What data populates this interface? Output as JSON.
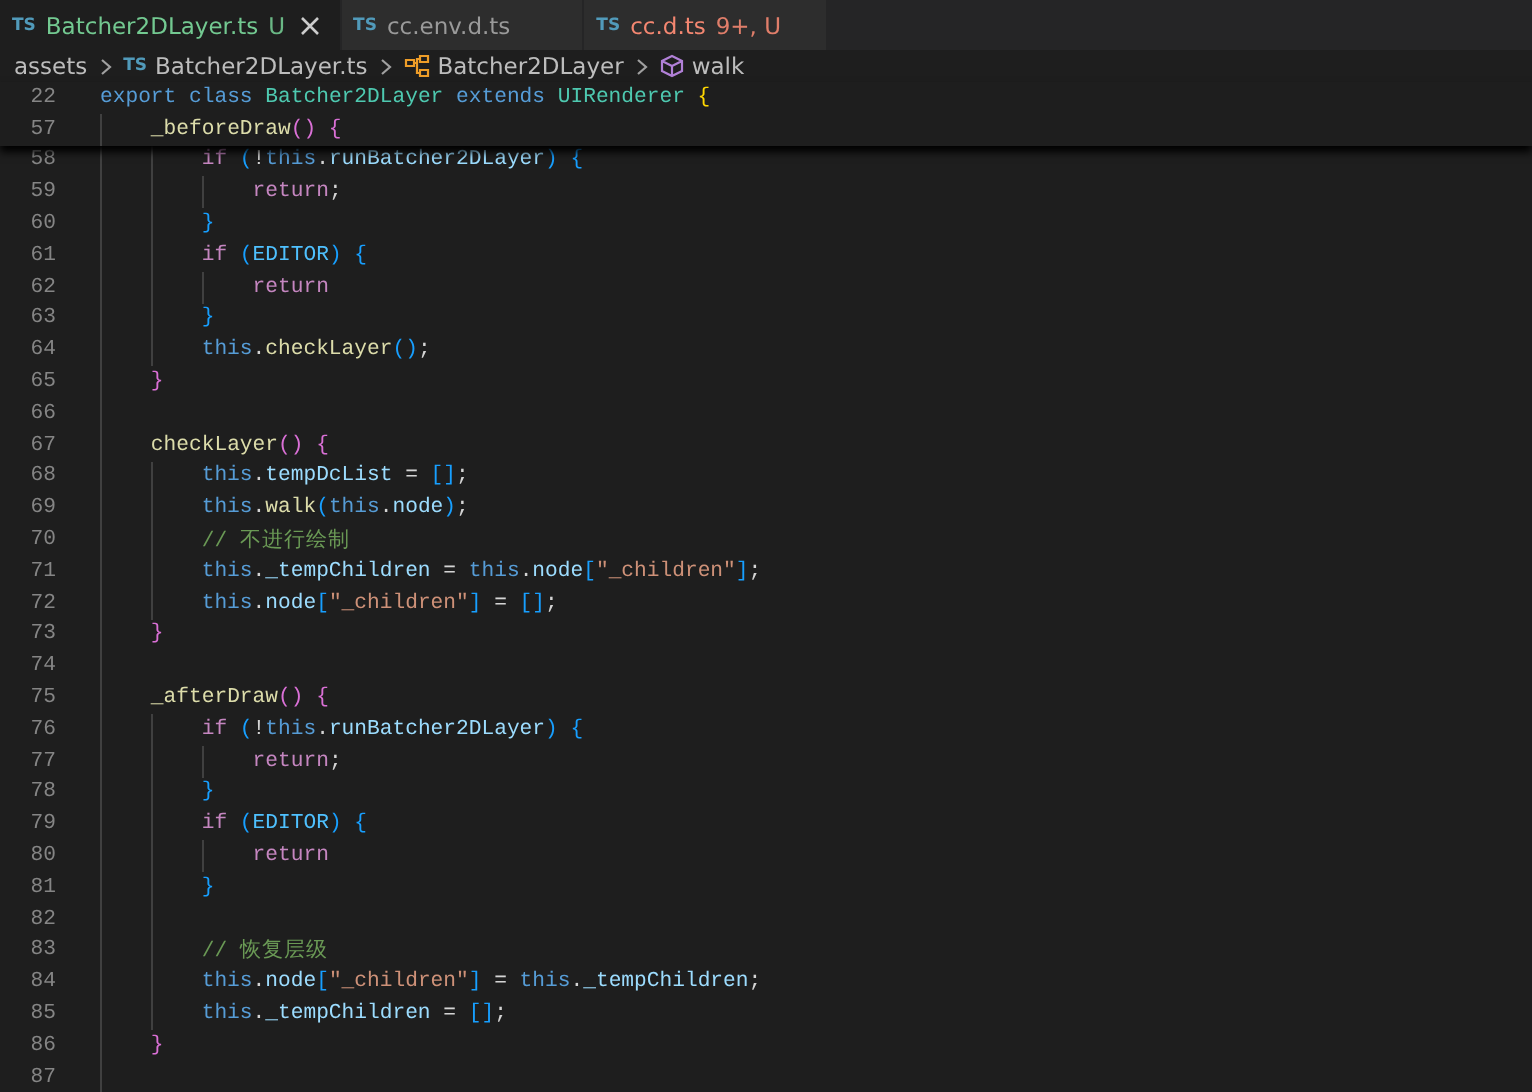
{
  "tabs": [
    {
      "badge": "TS",
      "label": "Batcher2DLayer.ts",
      "status": "U",
      "color": "#73c991",
      "selected": true
    },
    {
      "badge": "TS",
      "label": "cc.env.d.ts",
      "color": "#9a9a9a",
      "selected": false
    },
    {
      "badge": "TS",
      "label": "cc.d.ts",
      "status": "9+, U",
      "color": "#f48771",
      "selected": false
    }
  ],
  "breadcrumb": [
    {
      "text": "assets",
      "kind": "folder"
    },
    {
      "badge": "TS",
      "text": "Batcher2DLayer.ts",
      "kind": "file"
    },
    {
      "text": "Batcher2DLayer",
      "kind": "class"
    },
    {
      "text": "walk",
      "kind": "method"
    }
  ],
  "sticky_lines": [
    {
      "number": "22",
      "tokens": [
        {
          "text": "export class",
          "kind": "keyword"
        },
        {
          "text": " Batcher2DLayer",
          "kind": "type"
        },
        {
          "text": " extends",
          "kind": "keyword"
        },
        {
          "text": " UIRenderer",
          "kind": "type"
        },
        {
          "text": " {",
          "kind": "bracket1"
        }
      ]
    },
    {
      "number": "57",
      "tokens": [
        {
          "text": "    _beforeDraw",
          "kind": "function"
        },
        {
          "text": "() {",
          "kind": "bracket2"
        }
      ]
    }
  ],
  "lines": [
    {
      "number": "58",
      "tokens": [
        {
          "text": "        if",
          "kind": "control"
        },
        {
          "text": " (",
          "kind": "bracket3"
        },
        {
          "text": "!",
          "kind": "punctuation"
        },
        {
          "text": "this",
          "kind": "keyword"
        },
        {
          "text": ".",
          "kind": "punctuation"
        },
        {
          "text": "runBatcher2DLayer",
          "kind": "property"
        },
        {
          "text": ") {",
          "kind": "bracket3"
        }
      ]
    },
    {
      "number": "59",
      "tokens": [
        {
          "text": "            return",
          "kind": "control"
        },
        {
          "text": ";",
          "kind": "punctuation"
        }
      ]
    },
    {
      "number": "60",
      "tokens": [
        {
          "text": "        }",
          "kind": "bracket3"
        }
      ]
    },
    {
      "number": "61",
      "tokens": [
        {
          "text": "        if",
          "kind": "control"
        },
        {
          "text": " (",
          "kind": "bracket3"
        },
        {
          "text": "EDITOR",
          "kind": "constant"
        },
        {
          "text": ") {",
          "kind": "bracket3"
        }
      ]
    },
    {
      "number": "62",
      "tokens": [
        {
          "text": "            return",
          "kind": "control"
        }
      ]
    },
    {
      "number": "63",
      "tokens": [
        {
          "text": "        }",
          "kind": "bracket3"
        }
      ]
    },
    {
      "number": "64",
      "tokens": [
        {
          "text": "        this",
          "kind": "keyword"
        },
        {
          "text": ".",
          "kind": "punctuation"
        },
        {
          "text": "checkLayer",
          "kind": "function"
        },
        {
          "text": "()",
          "kind": "bracket3"
        },
        {
          "text": ";",
          "kind": "punctuation"
        }
      ]
    },
    {
      "number": "65",
      "tokens": [
        {
          "text": "    }",
          "kind": "bracket2"
        }
      ]
    },
    {
      "number": "66"
    },
    {
      "number": "67",
      "tokens": [
        {
          "text": "    checkLayer",
          "kind": "function"
        },
        {
          "text": "() {",
          "kind": "bracket2"
        }
      ]
    },
    {
      "number": "68",
      "tokens": [
        {
          "text": "        this",
          "kind": "keyword"
        },
        {
          "text": ".",
          "kind": "punctuation"
        },
        {
          "text": "tempDcList",
          "kind": "property"
        },
        {
          "text": " =",
          "kind": "punctuation"
        },
        {
          "text": " []",
          "kind": "bracket3"
        },
        {
          "text": ";",
          "kind": "punctuation"
        }
      ]
    },
    {
      "number": "69",
      "tokens": [
        {
          "text": "        this",
          "kind": "keyword"
        },
        {
          "text": ".",
          "kind": "punctuation"
        },
        {
          "text": "walk",
          "kind": "function"
        },
        {
          "text": "(",
          "kind": "bracket3"
        },
        {
          "text": "this",
          "kind": "keyword"
        },
        {
          "text": ".",
          "kind": "punctuation"
        },
        {
          "text": "node",
          "kind": "property"
        },
        {
          "text": ")",
          "kind": "bracket3"
        },
        {
          "text": ";",
          "kind": "punctuation"
        }
      ]
    },
    {
      "number": "70",
      "tokens": [
        {
          "text": "        // 不进行绘制",
          "kind": "comment"
        }
      ]
    },
    {
      "number": "71",
      "tokens": [
        {
          "text": "        this",
          "kind": "keyword"
        },
        {
          "text": ".",
          "kind": "punctuation"
        },
        {
          "text": "_tempChildren",
          "kind": "property"
        },
        {
          "text": " =",
          "kind": "punctuation"
        },
        {
          "text": " this",
          "kind": "keyword"
        },
        {
          "text": ".",
          "kind": "punctuation"
        },
        {
          "text": "node",
          "kind": "property"
        },
        {
          "text": "[",
          "kind": "bracket3"
        },
        {
          "text": "\"_children\"",
          "kind": "string"
        },
        {
          "text": "]",
          "kind": "bracket3"
        },
        {
          "text": ";",
          "kind": "punctuation"
        }
      ]
    },
    {
      "number": "72",
      "tokens": [
        {
          "text": "        this",
          "kind": "keyword"
        },
        {
          "text": ".",
          "kind": "punctuation"
        },
        {
          "text": "node",
          "kind": "property"
        },
        {
          "text": "[",
          "kind": "bracket3"
        },
        {
          "text": "\"_children\"",
          "kind": "string"
        },
        {
          "text": "]",
          "kind": "bracket3"
        },
        {
          "text": " =",
          "kind": "punctuation"
        },
        {
          "text": " []",
          "kind": "bracket3"
        },
        {
          "text": ";",
          "kind": "punctuation"
        }
      ]
    },
    {
      "number": "73",
      "tokens": [
        {
          "text": "    }",
          "kind": "bracket2"
        }
      ]
    },
    {
      "number": "74"
    },
    {
      "number": "75",
      "tokens": [
        {
          "text": "    _afterDraw",
          "kind": "function"
        },
        {
          "text": "() {",
          "kind": "bracket2"
        }
      ]
    },
    {
      "number": "76",
      "tokens": [
        {
          "text": "        if",
          "kind": "control"
        },
        {
          "text": " (",
          "kind": "bracket3"
        },
        {
          "text": "!",
          "kind": "punctuation"
        },
        {
          "text": "this",
          "kind": "keyword"
        },
        {
          "text": ".",
          "kind": "punctuation"
        },
        {
          "text": "runBatcher2DLayer",
          "kind": "property"
        },
        {
          "text": ") {",
          "kind": "bracket3"
        }
      ]
    },
    {
      "number": "77",
      "tokens": [
        {
          "text": "            return",
          "kind": "control"
        },
        {
          "text": ";",
          "kind": "punctuation"
        }
      ]
    },
    {
      "number": "78",
      "tokens": [
        {
          "text": "        }",
          "kind": "bracket3"
        }
      ]
    },
    {
      "number": "79",
      "tokens": [
        {
          "text": "        if",
          "kind": "control"
        },
        {
          "text": " (",
          "kind": "bracket3"
        },
        {
          "text": "EDITOR",
          "kind": "constant"
        },
        {
          "text": ") {",
          "kind": "bracket3"
        }
      ]
    },
    {
      "number": "80",
      "tokens": [
        {
          "text": "            return",
          "kind": "control"
        }
      ]
    },
    {
      "number": "81",
      "tokens": [
        {
          "text": "        }",
          "kind": "bracket3"
        }
      ]
    },
    {
      "number": "82"
    },
    {
      "number": "83",
      "tokens": [
        {
          "text": "        // 恢复层级",
          "kind": "comment"
        }
      ]
    },
    {
      "number": "84",
      "tokens": [
        {
          "text": "        this",
          "kind": "keyword"
        },
        {
          "text": ".",
          "kind": "punctuation"
        },
        {
          "text": "node",
          "kind": "property"
        },
        {
          "text": "[",
          "kind": "bracket3"
        },
        {
          "text": "\"_children\"",
          "kind": "string"
        },
        {
          "text": "]",
          "kind": "bracket3"
        },
        {
          "text": " =",
          "kind": "punctuation"
        },
        {
          "text": " this",
          "kind": "keyword"
        },
        {
          "text": ".",
          "kind": "punctuation"
        },
        {
          "text": "_tempChildren",
          "kind": "property"
        },
        {
          "text": ";",
          "kind": "punctuation"
        }
      ]
    },
    {
      "number": "85",
      "tokens": [
        {
          "text": "        this",
          "kind": "keyword"
        },
        {
          "text": ".",
          "kind": "punctuation"
        },
        {
          "text": "_tempChildren",
          "kind": "property"
        },
        {
          "text": " =",
          "kind": "punctuation"
        },
        {
          "text": " []",
          "kind": "bracket3"
        },
        {
          "text": ";",
          "kind": "punctuation"
        }
      ]
    },
    {
      "number": "86",
      "tokens": [
        {
          "text": "    }",
          "kind": "bracket2"
        }
      ]
    },
    {
      "number": "87"
    }
  ]
}
